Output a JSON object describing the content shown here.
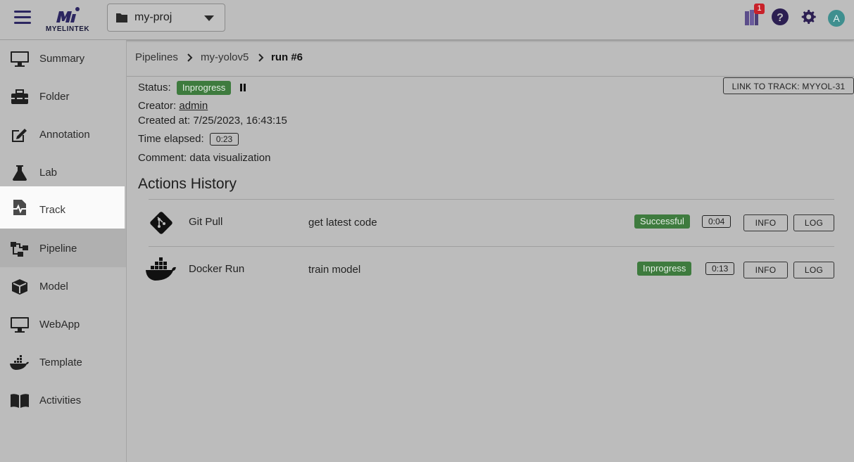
{
  "topbar": {
    "logo_text": "MyelinTek",
    "project": "my-proj",
    "notification_count": "1",
    "avatar_letter": "A"
  },
  "sidebar": {
    "items": [
      {
        "label": "Summary",
        "icon": "monitor-icon"
      },
      {
        "label": "Folder",
        "icon": "toolbox-icon"
      },
      {
        "label": "Annotation",
        "icon": "edit-icon"
      },
      {
        "label": "Lab",
        "icon": "flask-icon"
      },
      {
        "label": "Track",
        "icon": "track-file-icon"
      },
      {
        "label": "Pipeline",
        "icon": "pipeline-icon"
      },
      {
        "label": "Model",
        "icon": "cube-icon"
      },
      {
        "label": "WebApp",
        "icon": "monitor-icon"
      },
      {
        "label": "Template",
        "icon": "docker-icon"
      },
      {
        "label": "Activities",
        "icon": "book-icon"
      }
    ],
    "active": "Track"
  },
  "breadcrumb": [
    "Pipelines",
    "my-yolov5",
    "run #6"
  ],
  "run": {
    "status_label": "Status:",
    "status": "Inprogress",
    "creator_label": "Creator:",
    "creator": "admin",
    "created_at": "Created at: 7/25/2023, 16:43:15",
    "time_elapsed_label": "Time elapsed:",
    "time_elapsed": "0:23",
    "comment": "Comment: data visualization",
    "link_button": "LINK TO TRACK: MYYOL-31"
  },
  "actions": {
    "title": "Actions History",
    "rows": [
      {
        "name": "Git Pull",
        "desc": "get latest code",
        "status": "Successful",
        "time": "0:04",
        "info": "INFO",
        "log": "LOG",
        "icon": "git-icon"
      },
      {
        "name": "Docker Run",
        "desc": "train model",
        "status": "Inprogress",
        "time": "0:13",
        "info": "INFO",
        "log": "LOG",
        "icon": "docker-icon"
      }
    ]
  },
  "colors": {
    "accent": "#2c2660",
    "status_green": "#3e7b3e",
    "badge_red": "#c8222a",
    "avatar": "#3f8f8f"
  }
}
